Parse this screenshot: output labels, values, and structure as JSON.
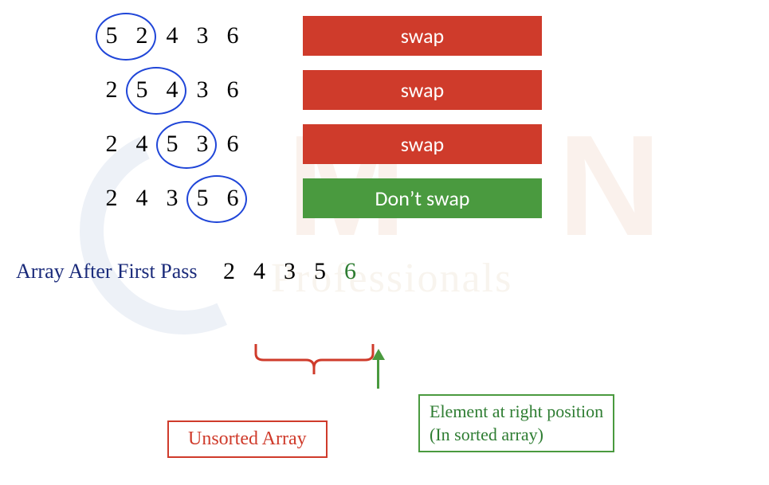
{
  "steps": [
    {
      "array": [
        "5",
        "2",
        "4",
        "3",
        "6"
      ],
      "circle_start": 0,
      "action": "swap",
      "color": "red"
    },
    {
      "array": [
        "2",
        "5",
        "4",
        "3",
        "6"
      ],
      "circle_start": 1,
      "action": "swap",
      "color": "red"
    },
    {
      "array": [
        "2",
        "4",
        "5",
        "3",
        "6"
      ],
      "circle_start": 2,
      "action": "swap",
      "color": "red"
    },
    {
      "array": [
        "2",
        "4",
        "3",
        "5",
        "6"
      ],
      "circle_start": 3,
      "action": "Don’t swap",
      "color": "green"
    }
  ],
  "result_label": "Array After First Pass",
  "result_array": [
    "2",
    "4",
    "3",
    "5",
    "6"
  ],
  "sorted_index": 4,
  "annotations": {
    "unsorted": "Unsorted Array",
    "sorted_line1": "Element at right position",
    "sorted_line2": "(In sorted array)"
  },
  "watermark": {
    "text": "Professionals"
  }
}
